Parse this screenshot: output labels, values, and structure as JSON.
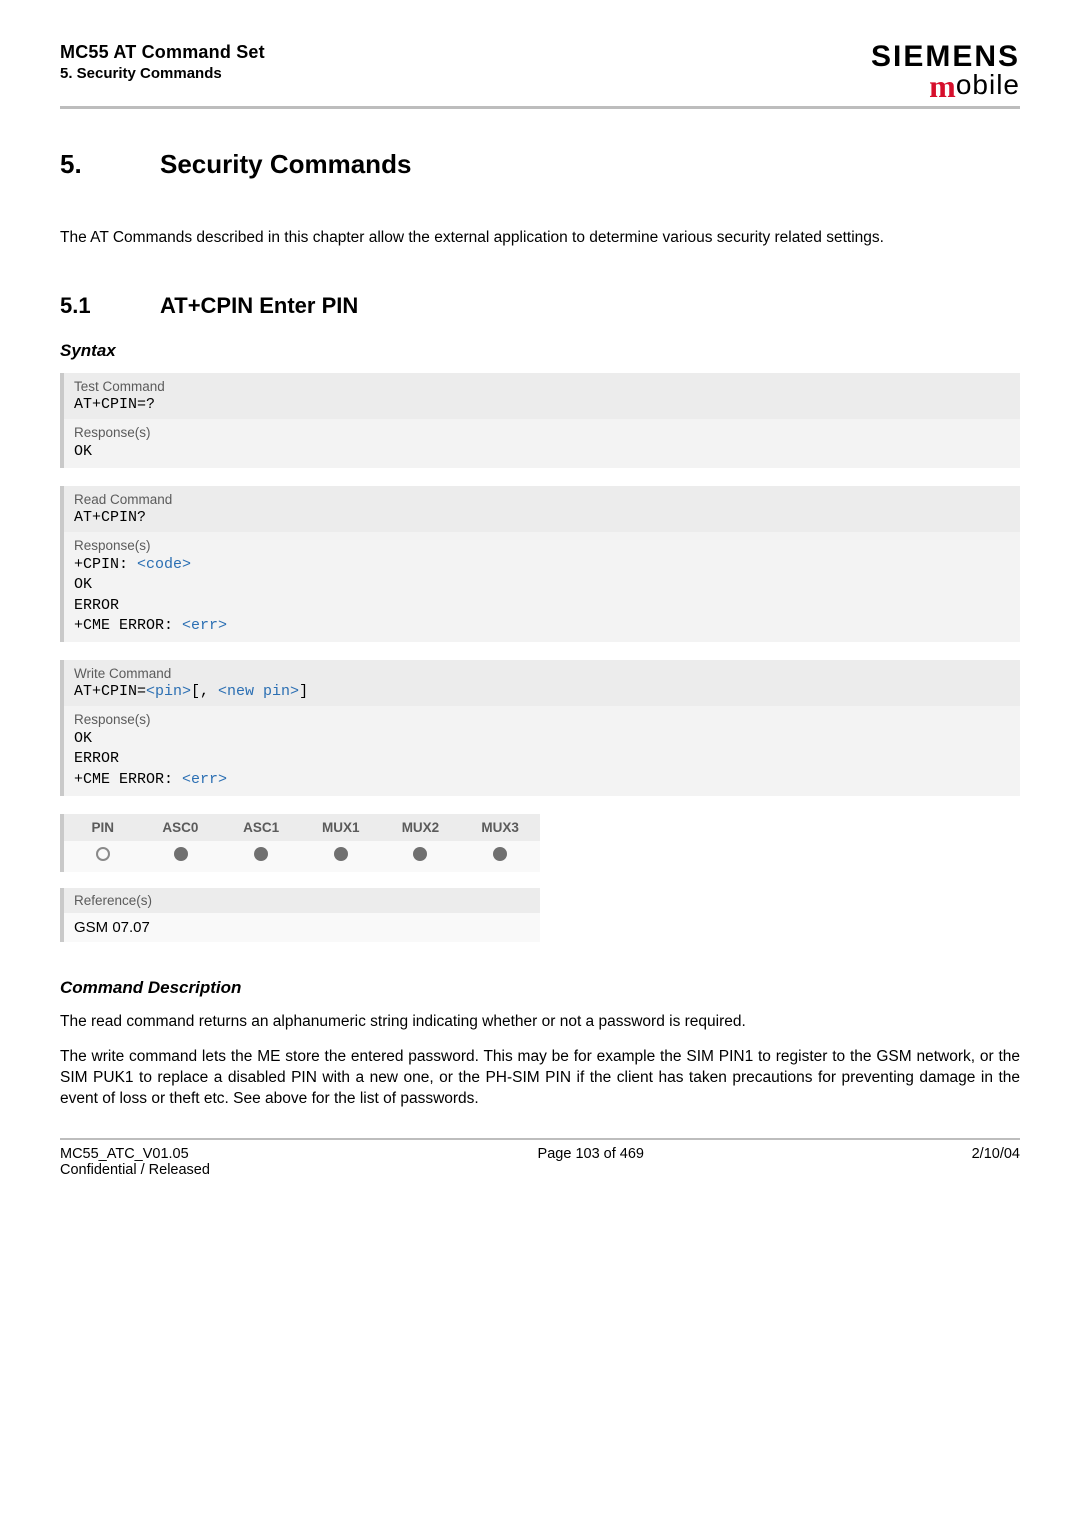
{
  "header": {
    "title_line1": "MC55 AT Command Set",
    "title_line2": "5. Security Commands",
    "brand_top": "SIEMENS",
    "brand_mobile_m": "m",
    "brand_mobile_rest": "obile"
  },
  "chapter": {
    "number": "5.",
    "title": "Security Commands",
    "intro": "The AT Commands described in this chapter allow the external application to determine various security related settings."
  },
  "section": {
    "number": "5.1",
    "title": "AT+CPIN   Enter PIN",
    "syntax_label": "Syntax"
  },
  "blocks": {
    "test": {
      "label": "Test Command",
      "command": "AT+CPIN=?",
      "response_label": "Response(s)",
      "response_lines": [
        "OK"
      ]
    },
    "read": {
      "label": "Read Command",
      "command": "AT+CPIN?",
      "response_label": "Response(s)",
      "response_prefix": "+CPIN: ",
      "response_param": "<code>",
      "response_lines_tail": [
        "OK",
        "ERROR"
      ],
      "response_cme_prefix": "+CME ERROR: ",
      "response_cme_param": "<err>"
    },
    "write": {
      "label": "Write Command",
      "command_prefix": "AT+CPIN=",
      "command_param1": "<pin>",
      "command_mid": "[, ",
      "command_param2": "<new pin>",
      "command_suffix": "]",
      "response_label": "Response(s)",
      "response_lines": [
        "OK",
        "ERROR"
      ],
      "response_cme_prefix": "+CME ERROR: ",
      "response_cme_param": "<err>"
    }
  },
  "caps": {
    "columns": [
      "PIN",
      "ASC0",
      "ASC1",
      "MUX1",
      "MUX2",
      "MUX3"
    ],
    "values": [
      "empty",
      "filled",
      "filled",
      "filled",
      "filled",
      "filled"
    ]
  },
  "reference": {
    "label": "Reference(s)",
    "value": "GSM 07.07"
  },
  "desc": {
    "label": "Command Description",
    "p1": "The read command returns an alphanumeric string indicating whether or not a password is required.",
    "p2": "The write command lets the ME store the entered password. This may be for example the SIM PIN1 to register to the GSM network, or the SIM PUK1 to replace a disabled PIN with a new one, or the PH-SIM PIN if the client has taken precautions for preventing damage in the event of loss or theft etc. See above for the list of passwords."
  },
  "footer": {
    "left_line1": "MC55_ATC_V01.05",
    "left_line2": "Confidential / Released",
    "center": "Page 103 of 469",
    "right": "2/10/04"
  }
}
